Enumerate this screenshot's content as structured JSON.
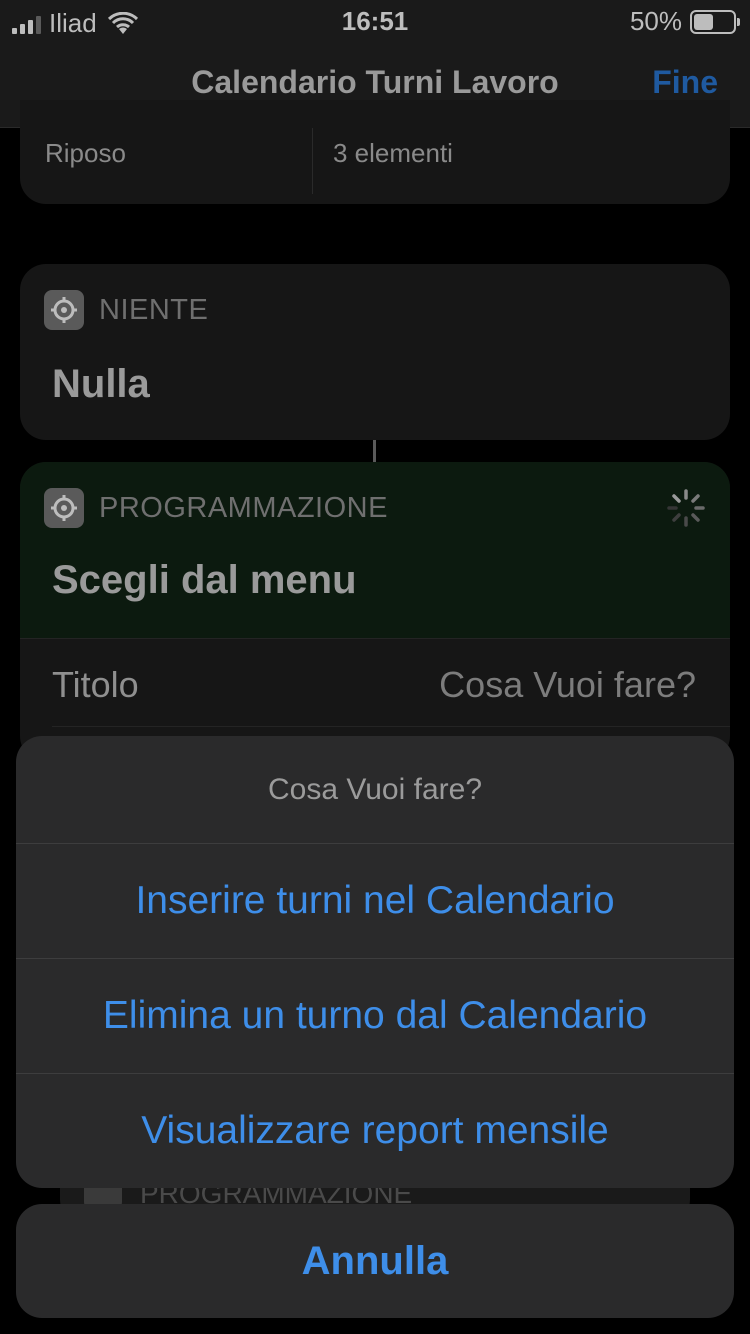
{
  "status_bar": {
    "carrier": "Iliad",
    "time": "16:51",
    "battery_percent": "50%",
    "battery_level": 0.5
  },
  "nav": {
    "title": "Calendario Turni Lavoro",
    "done_label": "Fine"
  },
  "riposo_row": {
    "label": "Riposo",
    "value": "3 elementi"
  },
  "niente_card": {
    "category": "NIENTE",
    "action": "Nulla",
    "icon": "gear-icon"
  },
  "programmazione_card": {
    "category": "PROGRAMMAZIONE",
    "action": "Scegli dal menu",
    "icon": "gear-icon",
    "title_label": "Titolo",
    "title_value": "Cosa Vuoi fare?"
  },
  "hidden_card": {
    "category": "PROGRAMMAZIONE"
  },
  "action_sheet": {
    "title": "Cosa Vuoi fare?",
    "options": [
      "Inserire turni nel Calendario",
      "Elimina un turno dal Calendario",
      "Visualizzare report mensile"
    ],
    "cancel_label": "Annulla",
    "accent_color": "#3e8ee9"
  }
}
